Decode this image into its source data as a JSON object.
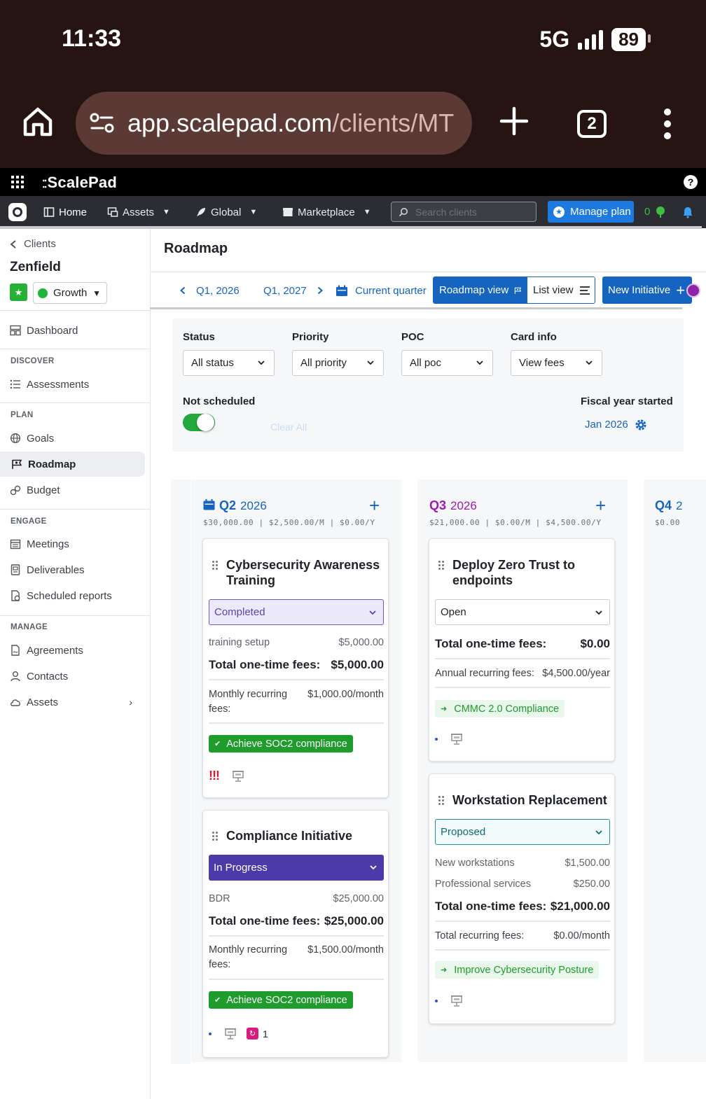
{
  "phone": {
    "time": "11:33",
    "network": "5G",
    "battery": "89"
  },
  "browser": {
    "url_host": "app.scalepad.com",
    "url_path": "/clients/MT",
    "tab_count": "2"
  },
  "app": {
    "brand": "ScalePad",
    "nav": {
      "home": "Home",
      "assets": "Assets",
      "global": "Global",
      "marketplace": "Marketplace",
      "search_placeholder": "Search clients",
      "manage_plan": "Manage plan",
      "count": "0"
    }
  },
  "sidebar": {
    "back_label": "Clients",
    "client_name": "Zenfield",
    "plan": "Growth",
    "dashboard": "Dashboard",
    "sections": {
      "discover": "DISCOVER",
      "plan": "PLAN",
      "engage": "ENGAGE",
      "manage": "MANAGE"
    },
    "items": {
      "assessments": "Assessments",
      "goals": "Goals",
      "roadmap": "Roadmap",
      "budget": "Budget",
      "meetings": "Meetings",
      "deliverables": "Deliverables",
      "scheduled_reports": "Scheduled reports",
      "agreements": "Agreements",
      "contacts": "Contacts",
      "assets": "Assets"
    }
  },
  "main": {
    "title": "Roadmap",
    "toolbar": {
      "prev_quarter": "Q1, 2026",
      "next_quarter": "Q1, 2027",
      "current_quarter": "Current quarter",
      "roadmap_view": "Roadmap view",
      "list_view": "List view",
      "new_initiative": "New Initiative"
    },
    "filters": {
      "status_label": "Status",
      "status_value": "All status",
      "priority_label": "Priority",
      "priority_value": "All priority",
      "poc_label": "POC",
      "poc_value": "All poc",
      "card_info_label": "Card info",
      "card_info_value": "View fees",
      "not_scheduled_label": "Not scheduled",
      "not_scheduled_on": true,
      "clear_all": "Clear All",
      "fiscal_year_label": "Fiscal year started",
      "fiscal_year_value": "Jan 2026"
    }
  },
  "columns": {
    "q2": {
      "quarter": "Q2",
      "year": "2026",
      "totals": "$30,000.00 | $2,500.00/M | $0.00/Y"
    },
    "q3": {
      "quarter": "Q3",
      "year": "2026",
      "totals": "$21,000.00 | $0.00/M | $4,500.00/Y"
    },
    "q4": {
      "quarter": "Q4",
      "year": "2",
      "totals": "$0.00"
    }
  },
  "cards": {
    "cyber": {
      "title": "Cybersecurity Awareness Training",
      "status": "Completed",
      "line_label": "training setup",
      "line_value": "$5,000.00",
      "total_label": "Total one-time fees:",
      "total_value": "$5,000.00",
      "recurring_label": "Monthly recurring fees:",
      "recurring_value": "$1,000.00/month",
      "goal": "Achieve SOC2 compliance",
      "priority": "!!!"
    },
    "compliance": {
      "title": "Compliance Initiative",
      "status": "In Progress",
      "line_label": "BDR",
      "line_value": "$25,000.00",
      "total_label": "Total one-time fees:",
      "total_value": "$25,000.00",
      "recurring_label": "Monthly recurring fees:",
      "recurring_value": "$1,500.00/month",
      "goal": "Achieve SOC2 compliance",
      "ticket_count": "1"
    },
    "zerotrust": {
      "title": "Deploy Zero Trust to endpoints",
      "status": "Open",
      "total_label": "Total one-time fees:",
      "total_value": "$0.00",
      "recurring_label": "Annual recurring fees:",
      "recurring_value": "$4,500.00/year",
      "goal": "CMMC 2.0 Compliance"
    },
    "workstation": {
      "title": "Workstation Replacement",
      "status": "Proposed",
      "line1_label": "New workstations",
      "line1_value": "$1,500.00",
      "line2_label": "Professional services",
      "line2_value": "$250.00",
      "total_label": "Total one-time fees:",
      "total_value": "$21,000.00",
      "recurring_label": "Total recurring fees:",
      "recurring_value": "$0.00/month",
      "goal": "Improve Cybersecurity Posture"
    }
  },
  "colors": {
    "primary": "#1565c0",
    "q3_accent": "#9c1ab1",
    "goal_green": "#1e9c2c",
    "in_progress": "#4b3aa8",
    "completed_bg": "#ece9fb"
  }
}
